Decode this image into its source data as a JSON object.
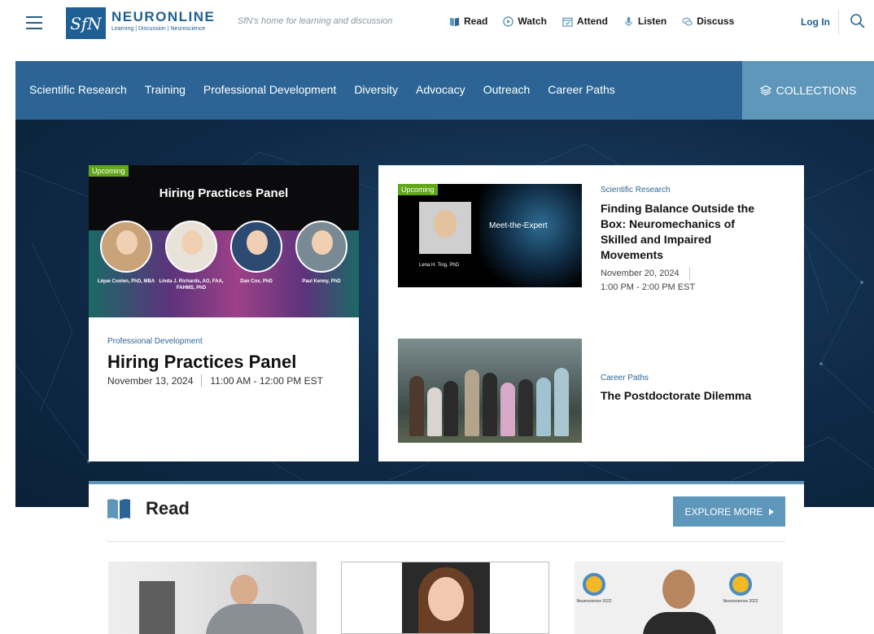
{
  "header": {
    "logo_mark": "SfN",
    "brand": "NEURONLINE",
    "brand_sub": "Learning | Discussion | Neuroscience",
    "tagline": "SfN's home for learning and discussion",
    "nav": [
      {
        "label": "Read",
        "icon": "book-icon"
      },
      {
        "label": "Watch",
        "icon": "play-icon"
      },
      {
        "label": "Attend",
        "icon": "calendar-icon"
      },
      {
        "label": "Listen",
        "icon": "microphone-icon"
      },
      {
        "label": "Discuss",
        "icon": "chat-icon"
      }
    ],
    "login": "Log In"
  },
  "catnav": {
    "items": [
      "Scientific Research",
      "Training",
      "Professional Development",
      "Diversity",
      "Advocacy",
      "Outreach",
      "Career Paths"
    ],
    "collections": "COLLECTIONS"
  },
  "featured": {
    "badge": "Upcoming",
    "image_title": "Hiring Practices Panel",
    "panelists": [
      "Lique Coolen, PhD, MBA",
      "Linda J. Richards, AO, FAA, FAHMS, PhD",
      "Dan Cox, PhD",
      "Paul Kenny, PhD"
    ],
    "category": "Professional Development",
    "title": "Hiring Practices Panel",
    "date": "November 13, 2024",
    "time": "11:00 AM - 12:00 PM EST"
  },
  "articles": [
    {
      "badge": "Upcoming",
      "image_text": "Meet-the-Expert",
      "image_caption": "Lena H. Ting, PhD",
      "category": "Scientific Research",
      "title": "Finding Balance Outside the Box: Neuromechanics of Skilled and Impaired Movements",
      "date": "November 20, 2024",
      "time": "1:00 PM - 2:00 PM EST"
    },
    {
      "category": "Career Paths",
      "title": "The Postdoctorate Dilemma"
    }
  ],
  "read": {
    "title": "Read",
    "explore": "EXPLORE MORE",
    "thumb3_text": [
      "Neuroscience 2022",
      "Neuroscience 2022"
    ]
  },
  "colors": {
    "brand_blue": "#1f5f93",
    "nav_blue": "#2c6595",
    "accent_blue": "#5f97bb",
    "badge_green": "#61a616",
    "hero_navy": "#0f2a47"
  }
}
